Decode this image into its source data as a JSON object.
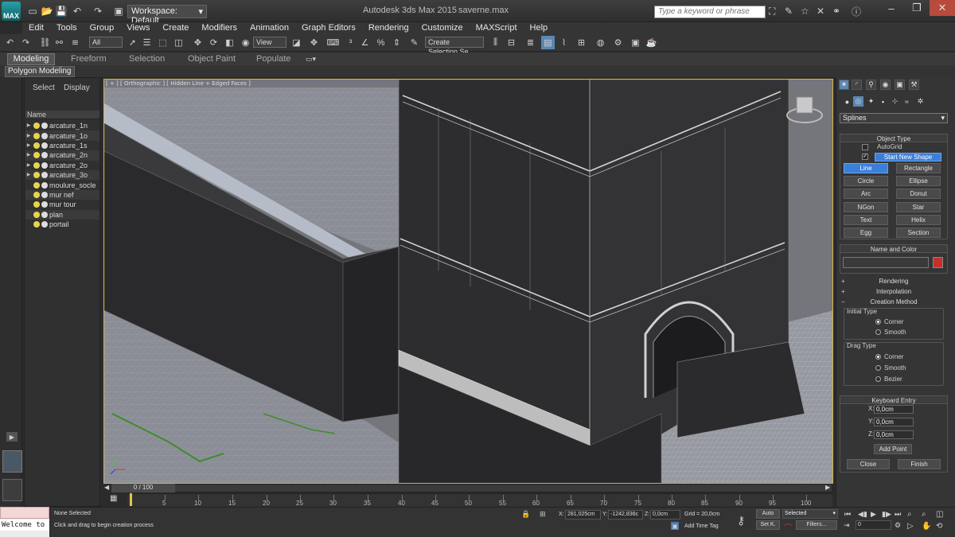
{
  "title_bar": {
    "app_logo": "MAX",
    "workspace": "Workspace: Default",
    "app_title": "Autodesk 3ds Max  2015",
    "file_name": "saverne.max",
    "search_placeholder": "Type a keyword or phrase"
  },
  "menu": [
    "Edit",
    "Tools",
    "Group",
    "Views",
    "Create",
    "Modifiers",
    "Animation",
    "Graph Editors",
    "Rendering",
    "Customize",
    "MAXScript",
    "Help"
  ],
  "toolbar": {
    "filter_select": "All",
    "ref_coord": "View",
    "selection_set": "Create Selection Se"
  },
  "ribbon": {
    "tabs": [
      "Modeling",
      "Freeform",
      "Selection",
      "Object Paint",
      "Populate"
    ],
    "sub": "Polygon Modeling"
  },
  "explorer": {
    "tabs": [
      "Select",
      "Display"
    ],
    "column": "Name",
    "items": [
      "arcature_1n",
      "arcature_1o",
      "arcature_1s",
      "arcature_2n",
      "arcature_2o",
      "arcature_3o",
      "moulure_socle",
      "mur nef",
      "mur tour",
      "plan",
      "portail"
    ]
  },
  "viewport": {
    "label": "[ + ] [ Orthographic ] [ Hidden Line + Edged Faces ]"
  },
  "timeline": {
    "frame": "0 / 100",
    "ticks": [
      "5",
      "10",
      "15",
      "20",
      "25",
      "30",
      "35",
      "40",
      "45",
      "50",
      "55",
      "60",
      "65",
      "70",
      "75",
      "80",
      "85",
      "90",
      "95",
      "100"
    ]
  },
  "command_panel": {
    "category": "Splines",
    "object_type_title": "Object Type",
    "autogrid": "AutoGrid",
    "start_new_shape": "Start New Shape",
    "buttons": [
      "Line",
      "Rectangle",
      "Circle",
      "Ellipse",
      "Arc",
      "Donut",
      "NGon",
      "Star",
      "Text",
      "Helix",
      "Egg",
      "Section"
    ],
    "name_color_title": "Name and Color",
    "swatch_color": "#c4302b",
    "rendering": "Rendering",
    "interpolation": "Interpolation",
    "creation_method": "Creation Method",
    "initial_type": "Initial Type",
    "initial_options": [
      "Corner",
      "Smooth"
    ],
    "drag_type": "Drag Type",
    "drag_options": [
      "Corner",
      "Smooth",
      "Bezier"
    ],
    "keyboard_entry": "Keyboard Entry",
    "x_label": "X:",
    "y_label": "Y:",
    "z_label": "Z:",
    "x_val": "0,0cm",
    "y_val": "0,0cm",
    "z_val": "0,0cm",
    "add_point": "Add Point",
    "close": "Close",
    "finish": "Finish"
  },
  "status": {
    "listener": "Welcome to",
    "selection": "None Selected",
    "prompt": "Click and drag to begin creation process",
    "x_label": "X:",
    "x": "281,025cm",
    "y_label": "Y:",
    "y": "-1242,836c",
    "z_label": "Z:",
    "z": "0,0cm",
    "grid": "Grid = 20,0cm",
    "add_time_tag": "Add Time Tag",
    "auto": "Auto",
    "selected": "Selected",
    "set_k": "Set K.",
    "filters": "Filters...",
    "frame_field": "0"
  }
}
